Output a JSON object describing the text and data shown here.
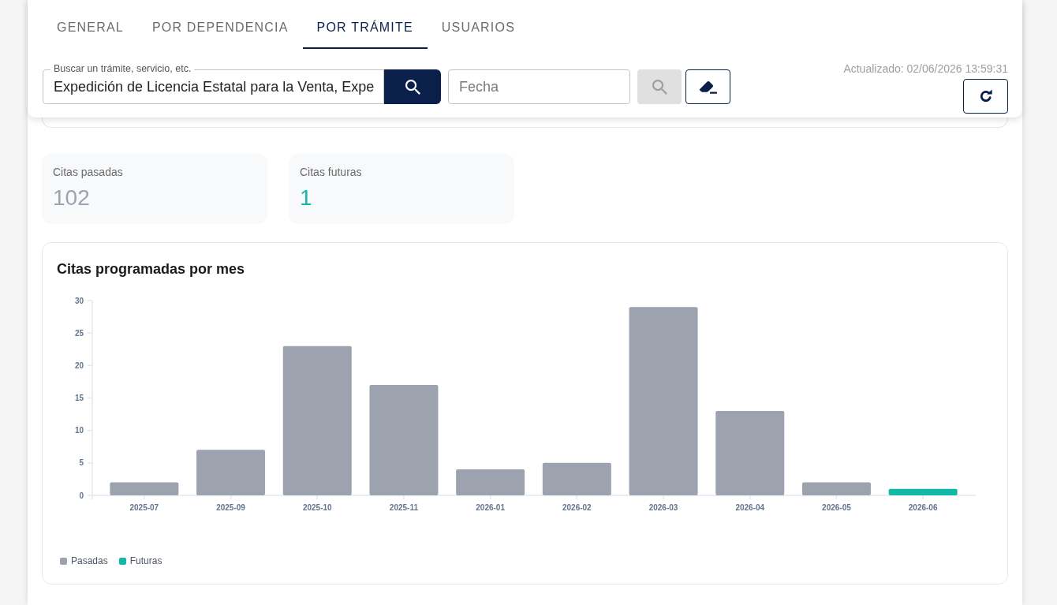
{
  "tabs": [
    {
      "label": "GENERAL",
      "selected": false
    },
    {
      "label": "POR DEPENDENCIA",
      "selected": false
    },
    {
      "label": "POR TRÁMITE",
      "selected": true
    },
    {
      "label": "USUARIOS",
      "selected": false
    }
  ],
  "search": {
    "label": "Buscar un trámite, servicio, etc.",
    "value": "Expedición de Licencia Estatal para la Venta, Expe"
  },
  "date_field": {
    "placeholder": "Fecha"
  },
  "date_search": {
    "disabled": true
  },
  "updated": "Actualizado: 02/06/2026 13:59:31",
  "stats": [
    {
      "label": "Citas pasadas",
      "value": "102",
      "color": "#9ca3af"
    },
    {
      "label": "Citas futuras",
      "value": "1",
      "color": "#14b8a6"
    }
  ],
  "chart": {
    "chart_data": {
      "type": "bar",
      "title": "Citas programadas por mes",
      "categories": [
        "2025-07",
        "2025-09",
        "2025-10",
        "2025-11",
        "2026-01",
        "2026-02",
        "2026-03",
        "2026-04",
        "2026-05",
        "2026-06"
      ],
      "series": [
        {
          "name": "Pasadas",
          "color": "#9ca3af",
          "values": [
            2,
            7,
            23,
            17,
            4,
            5,
            29,
            13,
            2,
            0
          ]
        },
        {
          "name": "Futuras",
          "color": "#14b8a6",
          "values": [
            0,
            0,
            0,
            0,
            0,
            0,
            0,
            0,
            0,
            1
          ]
        }
      ],
      "ylim": [
        0,
        30
      ],
      "yticks": [
        0,
        5,
        10,
        15,
        20,
        25,
        30
      ],
      "stacked": true
    }
  }
}
